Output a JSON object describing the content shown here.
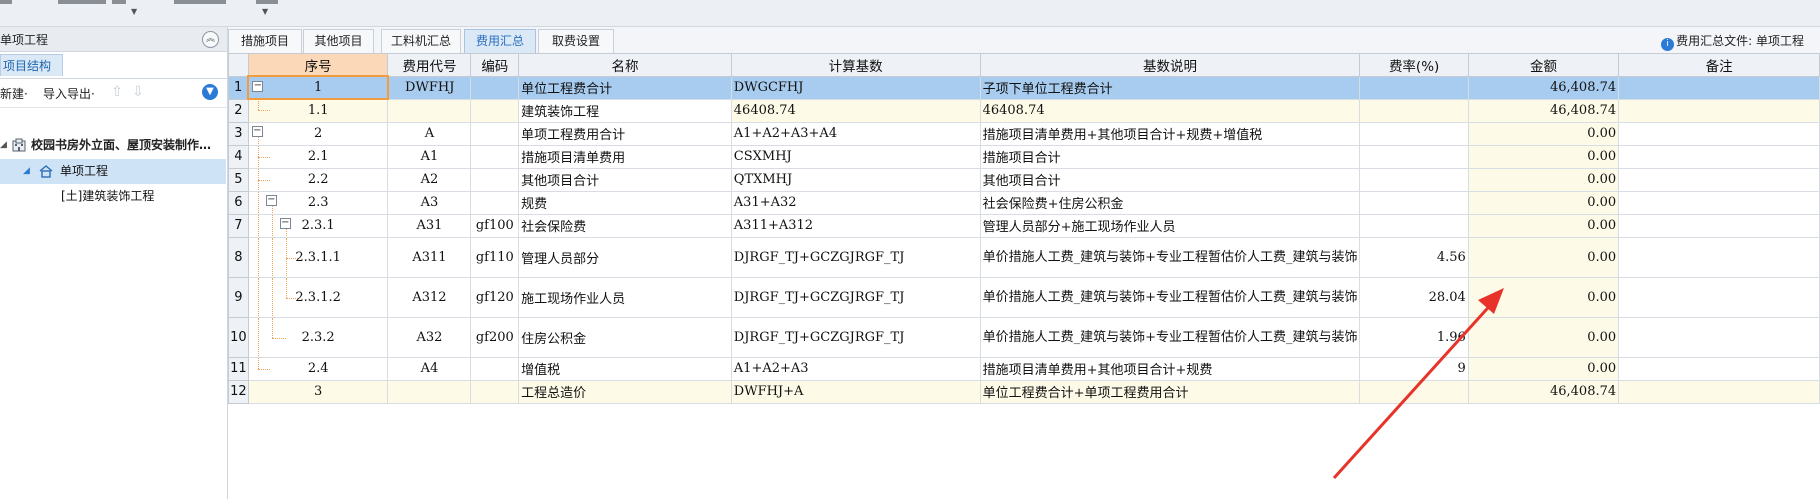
{
  "left_panel": {
    "title": "单项工程",
    "tab_label": "项目结构",
    "toolbar": {
      "new_label": "新建·",
      "import_export_label": "导入导出·"
    },
    "tree": [
      {
        "label": "校园书房外立面、屋顶安装制作…",
        "icon": "building-icon"
      },
      {
        "label": "单项工程",
        "icon": "home-icon",
        "selected": true
      },
      {
        "label": "[土]建筑装饰工程",
        "icon": ""
      }
    ]
  },
  "tabs": [
    {
      "label": "措施项目"
    },
    {
      "label": "其他项目"
    },
    {
      "label": "工料机汇总"
    },
    {
      "label": "费用汇总",
      "active": true
    },
    {
      "label": "取费设置"
    }
  ],
  "summary_file_label": "费用汇总文件: 单项工程",
  "columns": [
    "序号",
    "费用代号",
    "编码",
    "名称",
    "计算基数",
    "基数说明",
    "费率(%)",
    "金额",
    "备注"
  ],
  "rows": [
    {
      "rownum": "1",
      "seq": "1",
      "code": "DWFHJ",
      "bm": "",
      "name": "单位工程费合计",
      "base": "DWGCFHJ",
      "desc": "子项下单位工程费合计",
      "rate": "",
      "amount": "46,408.74",
      "note": ""
    },
    {
      "rownum": "2",
      "seq": "1.1",
      "code": "",
      "bm": "",
      "name": "建筑装饰工程",
      "base": "46408.74",
      "desc": "46408.74",
      "rate": "",
      "amount": "46,408.74",
      "note": ""
    },
    {
      "rownum": "3",
      "seq": "2",
      "code": "A",
      "bm": "",
      "name": "单项工程费用合计",
      "base": "A1+A2+A3+A4",
      "desc": "措施项目清单费用+其他项目合计+规费+增值税",
      "rate": "",
      "amount": "0.00",
      "note": ""
    },
    {
      "rownum": "4",
      "seq": "2.1",
      "code": "A1",
      "bm": "",
      "name": "措施项目清单费用",
      "base": "CSXMHJ",
      "desc": "措施项目合计",
      "rate": "",
      "amount": "0.00",
      "note": ""
    },
    {
      "rownum": "5",
      "seq": "2.2",
      "code": "A2",
      "bm": "",
      "name": "其他项目合计",
      "base": "QTXMHJ",
      "desc": "其他项目合计",
      "rate": "",
      "amount": "0.00",
      "note": ""
    },
    {
      "rownum": "6",
      "seq": "2.3",
      "code": "A3",
      "bm": "",
      "name": "规费",
      "base": "A31+A32",
      "desc": "社会保险费+住房公积金",
      "rate": "",
      "amount": "0.00",
      "note": ""
    },
    {
      "rownum": "7",
      "seq": "2.3.1",
      "code": "A31",
      "bm": "gf100",
      "name": "社会保险费",
      "base": "A311+A312",
      "desc": "管理人员部分+施工现场作业人员",
      "rate": "",
      "amount": "0.00",
      "note": ""
    },
    {
      "rownum": "8",
      "seq": "2.3.1.1",
      "code": "A311",
      "bm": "gf110",
      "name": "管理人员部分",
      "base": "DJRGF_TJ+GCZGJRGF_TJ",
      "desc": "单价措施人工费_建筑与装饰+专业工程暂估价人工费_建筑与装饰",
      "rate": "4.56",
      "amount": "0.00",
      "note": ""
    },
    {
      "rownum": "9",
      "seq": "2.3.1.2",
      "code": "A312",
      "bm": "gf120",
      "name": "施工现场作业人员",
      "base": "DJRGF_TJ+GCZGJRGF_TJ",
      "desc": "单价措施人工费_建筑与装饰+专业工程暂估价人工费_建筑与装饰",
      "rate": "28.04",
      "amount": "0.00",
      "note": ""
    },
    {
      "rownum": "10",
      "seq": "2.3.2",
      "code": "A32",
      "bm": "gf200",
      "name": "住房公积金",
      "base": "DJRGF_TJ+GCZGJRGF_TJ",
      "desc": "单价措施人工费_建筑与装饰+专业工程暂估价人工费_建筑与装饰",
      "rate": "1.96",
      "amount": "0.00",
      "note": ""
    },
    {
      "rownum": "11",
      "seq": "2.4",
      "code": "A4",
      "bm": "",
      "name": "增值税",
      "base": "A1+A2+A3",
      "desc": "措施项目清单费用+其他项目合计+规费",
      "rate": "9",
      "amount": "0.00",
      "note": ""
    },
    {
      "rownum": "12",
      "seq": "3",
      "code": "",
      "bm": "",
      "name": "工程总造价",
      "base": "DWFHJ+A",
      "desc": "单位工程费合计+单项工程费用合计",
      "rate": "",
      "amount": "46,408.74",
      "note": ""
    }
  ],
  "colors": {
    "selected_row": "#a8ccef",
    "header_highlight": "#fbd9b8",
    "amount_bg": "#fdfbe7",
    "arrow": "#e8332a",
    "tab_active": "#dbe8f6"
  }
}
